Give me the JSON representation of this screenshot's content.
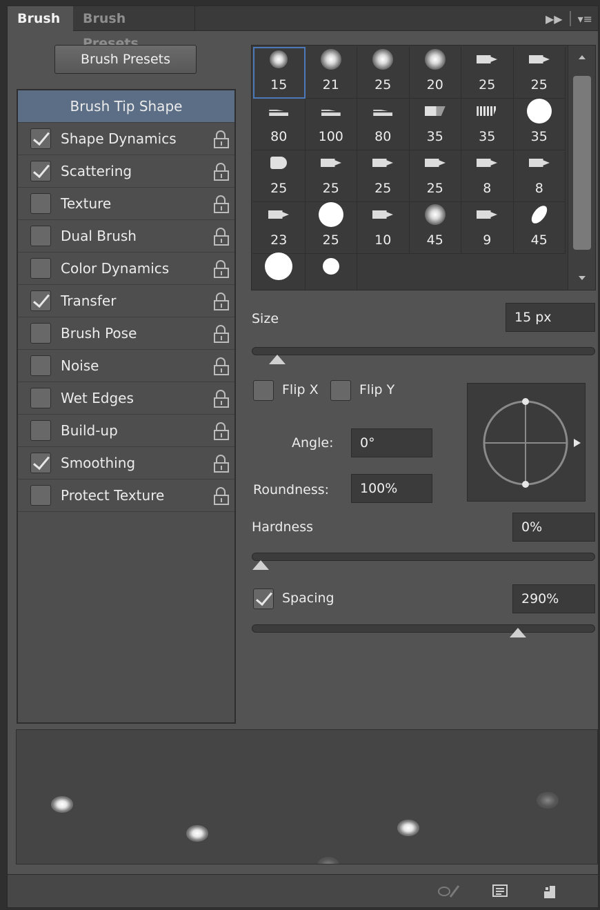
{
  "tabs": [
    {
      "label": "Brush",
      "active": true
    },
    {
      "label": "Brush Presets",
      "active": false
    }
  ],
  "header_icons": [
    "fast-forward-icon",
    "panel-menu-icon"
  ],
  "presets_button_label": "Brush Presets",
  "options": {
    "header": "Brush Tip Shape",
    "items": [
      {
        "label": "Shape Dynamics",
        "checked": true
      },
      {
        "label": "Scattering",
        "checked": true
      },
      {
        "label": "Texture",
        "checked": false
      },
      {
        "label": "Dual Brush",
        "checked": false
      },
      {
        "label": "Color Dynamics",
        "checked": false
      },
      {
        "label": "Transfer",
        "checked": true
      },
      {
        "label": "Brush Pose",
        "checked": false
      },
      {
        "label": "Noise",
        "checked": false
      },
      {
        "label": "Wet Edges",
        "checked": false
      },
      {
        "label": "Build-up",
        "checked": false
      },
      {
        "label": "Smoothing",
        "checked": true
      },
      {
        "label": "Protect Texture",
        "checked": false
      }
    ]
  },
  "brush_tips": [
    {
      "size": "15",
      "shape": "soft",
      "selected": true
    },
    {
      "size": "21",
      "shape": "soft"
    },
    {
      "size": "25",
      "shape": "soft"
    },
    {
      "size": "20",
      "shape": "soft"
    },
    {
      "size": "25",
      "shape": "marker"
    },
    {
      "size": "25",
      "shape": "marker"
    },
    {
      "size": "80",
      "shape": "bristle"
    },
    {
      "size": "100",
      "shape": "bristle"
    },
    {
      "size": "80",
      "shape": "bristle"
    },
    {
      "size": "35",
      "shape": "fan"
    },
    {
      "size": "35",
      "shape": "comb"
    },
    {
      "size": "35",
      "shape": "hard"
    },
    {
      "size": "25",
      "shape": "drop"
    },
    {
      "size": "25",
      "shape": "marker"
    },
    {
      "size": "25",
      "shape": "marker"
    },
    {
      "size": "25",
      "shape": "marker"
    },
    {
      "size": "8",
      "shape": "marker"
    },
    {
      "size": "8",
      "shape": "marker"
    },
    {
      "size": "23",
      "shape": "marker"
    },
    {
      "size": "25",
      "shape": "hard"
    },
    {
      "size": "10",
      "shape": "marker"
    },
    {
      "size": "45",
      "shape": "soft"
    },
    {
      "size": "9",
      "shape": "marker"
    },
    {
      "size": "45",
      "shape": "leaf"
    },
    {
      "size": "",
      "shape": "hard-lg"
    },
    {
      "size": "",
      "shape": "hard-sm"
    }
  ],
  "size": {
    "label": "Size",
    "value": "15 px",
    "slider_fraction": 0.05
  },
  "flip_x": {
    "label": "Flip X",
    "checked": false
  },
  "flip_y": {
    "label": "Flip Y",
    "checked": false
  },
  "angle": {
    "label": "Angle:",
    "value": "0°"
  },
  "roundness": {
    "label": "Roundness:",
    "value": "100%"
  },
  "hardness": {
    "label": "Hardness",
    "value": "0%",
    "slider_fraction": 0.0
  },
  "spacing": {
    "label": "Spacing",
    "value": "290%",
    "checked": true,
    "slider_fraction": 0.79
  },
  "bottom_icons": [
    "brush-toggle-icon",
    "grid-icon",
    "new-preset-icon"
  ],
  "colors": {
    "panel": "#535353",
    "selected": "#5b6e86",
    "field": "#3b3b3b",
    "selection_outline": "#4b79b9"
  }
}
